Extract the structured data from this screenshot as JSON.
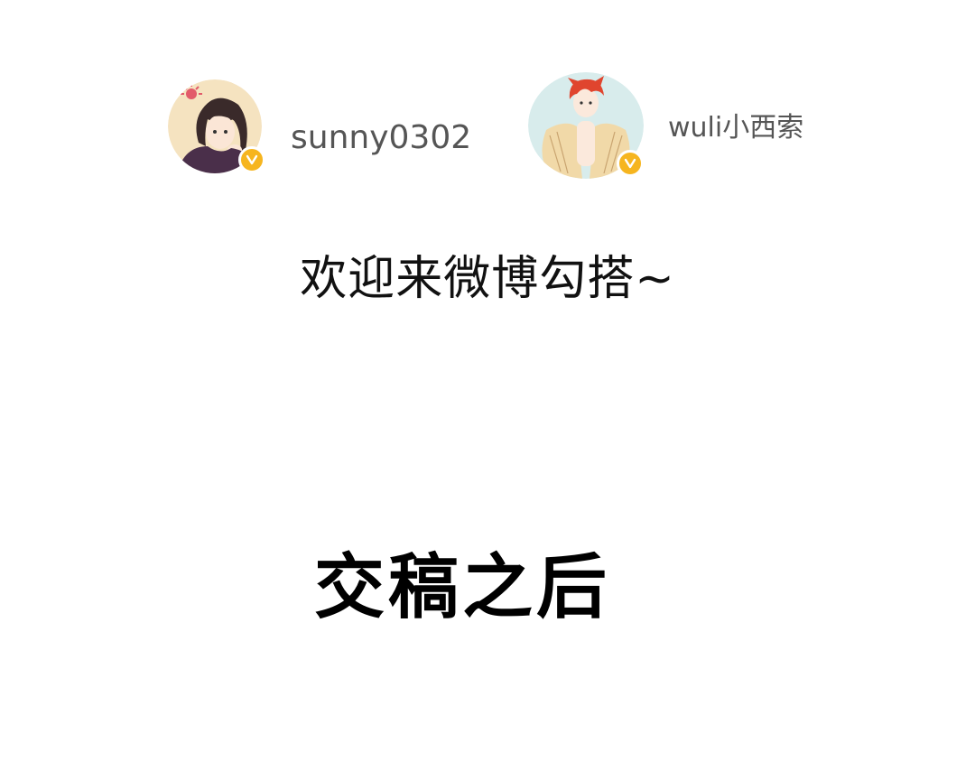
{
  "authors": [
    {
      "username": "sunny0302",
      "avatar_icon": "girl-avatar-icon",
      "badge_icon": "verified-v-icon",
      "badge_color": "#f6b51f"
    },
    {
      "username": "wuli小西索",
      "avatar_icon": "red-hair-boy-avatar-icon",
      "badge_icon": "verified-v-icon",
      "badge_color": "#f6b51f"
    }
  ],
  "welcome_text": "欢迎来微博勾搭~",
  "headline": "交稿之后"
}
